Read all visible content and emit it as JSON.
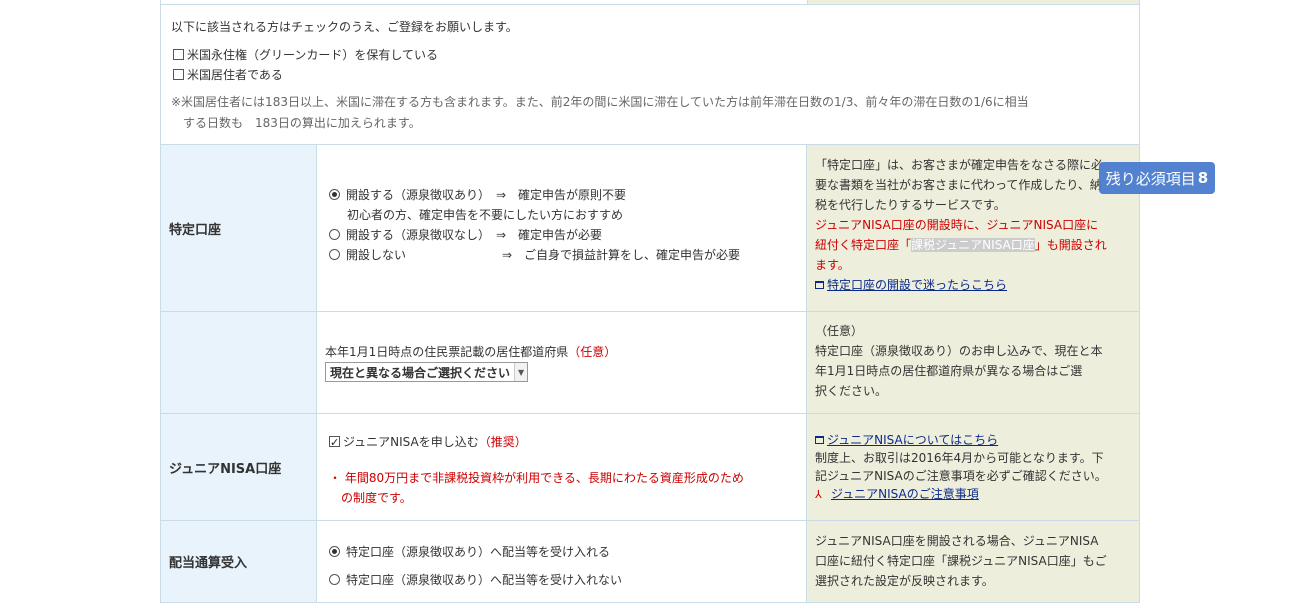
{
  "us_person": {
    "lead": "以下に該当される方はチェックのうえ、ご登録をお願いします。",
    "options": [
      "米国永住権（グリーンカード）を保有している",
      "米国居住者である"
    ],
    "note_line1": "※米国居住者には183日以上、米国に滞在する方も含まれます。また、前2年の間に米国に滞在していた方は前年滞在日数の1/3、前々年の滞在日数の1/6に相当",
    "note_line2": "する日数も　183日の算出に加えられます。"
  },
  "tokutei": {
    "label": "特定口座",
    "options": [
      {
        "text": "開設する（源泉徴収あり）　⇒　確定申告が原則不要",
        "sub": "初心者の方、確定申告を不要にしたい方におすすめ",
        "selected": true
      },
      {
        "text": "開設する（源泉徴収なし）　⇒　確定申告が必要",
        "selected": false
      },
      {
        "text": "開設しない　　　　　　　　⇒　ご自身で損益計算をし、確定申告が必要",
        "selected": false
      }
    ],
    "note_line1": "「特定口座」は、お客さまが確定申告をなさる際に必",
    "note_line2": "要な書類を当社がお客さまに代わって作成したり、納",
    "note_line3": "税を代行したりするサービスです。",
    "note_red1": "ジュニアNISA口座の開設時に、ジュニアNISA口座に",
    "note_red2a": "紐付く特定口座「",
    "note_red2_hl": "課税ジュニアNISA口座",
    "note_red2b": "」も開設され",
    "note_red3": "ます。",
    "note_link": "特定口座の開設で迷ったらこちら"
  },
  "prefecture": {
    "label": "本年1月1日時点の住民票記載の居住都道府県",
    "optional": "（任意）",
    "select_value": "現在と異なる場合ご選択ください",
    "note_line1": "（任意）",
    "note_line2": "特定口座（源泉徴収あり）のお申し込みで、現在と本",
    "note_line3": "年1月1日時点の居住都道府県が異なる場合はご選",
    "note_line4": "択ください。"
  },
  "junior_nisa": {
    "label": "ジュニアNISA口座",
    "checkbox_label": "ジュニアNISAを申し込む",
    "recommend": "（推奨）",
    "bullet_line1": "・ 年間80万円まで非課税投資枠が利用できる、長期にわたる資産形成のため",
    "bullet_line2": "の制度です。",
    "note_link1": "ジュニアNISAについてはこちら",
    "note_line1": "制度上、お取引は2016年4月から可能となります。下",
    "note_line2": "記ジュニアNISAのご注意事項を必ずご確認ください。",
    "note_link2": "ジュニアNISAのご注意事項"
  },
  "dividend": {
    "label": "配当通算受入",
    "options": [
      {
        "text": "特定口座（源泉徴収あり）へ配当等を受け入れる",
        "selected": true
      },
      {
        "text": "特定口座（源泉徴収あり）へ配当等を受け入れない",
        "selected": false
      }
    ],
    "note_line1": "ジュニアNISA口座を開設される場合、ジュニアNISA",
    "note_line2": "口座に紐付く特定口座「課税ジュニアNISA口座」もご",
    "note_line3": "選択された設定が反映されます。"
  },
  "badge": {
    "label": "残り必須項目",
    "count": "8",
    "color": "#4a7ccf"
  }
}
